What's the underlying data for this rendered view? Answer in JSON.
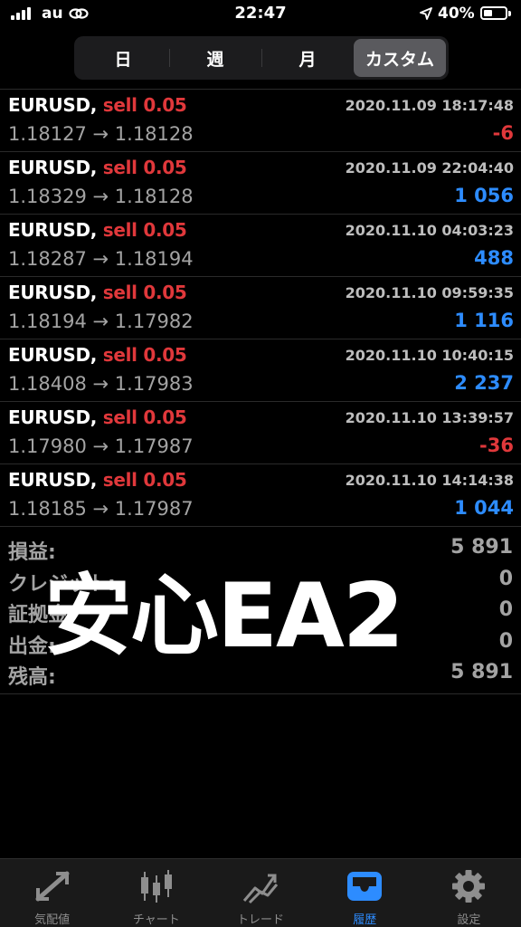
{
  "status_bar": {
    "carrier": "au",
    "time": "22:47",
    "battery": "40%",
    "battery_level": 0.4
  },
  "segments": [
    {
      "label": "日",
      "active": false
    },
    {
      "label": "週",
      "active": false
    },
    {
      "label": "月",
      "active": false
    },
    {
      "label": "カスタム",
      "active": true
    }
  ],
  "trades": [
    {
      "symbol": "EURUSD,",
      "side": "sell 0.05",
      "time": "2020.11.09 18:17:48",
      "prices": "1.18127 → 1.18128",
      "profit": "-6",
      "positive": false
    },
    {
      "symbol": "EURUSD,",
      "side": "sell 0.05",
      "time": "2020.11.09 22:04:40",
      "prices": "1.18329 → 1.18128",
      "profit": "1 056",
      "positive": true
    },
    {
      "symbol": "EURUSD,",
      "side": "sell 0.05",
      "time": "2020.11.10 04:03:23",
      "prices": "1.18287 → 1.18194",
      "profit": "488",
      "positive": true
    },
    {
      "symbol": "EURUSD,",
      "side": "sell 0.05",
      "time": "2020.11.10 09:59:35",
      "prices": "1.18194 → 1.17982",
      "profit": "1 116",
      "positive": true
    },
    {
      "symbol": "EURUSD,",
      "side": "sell 0.05",
      "time": "2020.11.10 10:40:15",
      "prices": "1.18408 → 1.17983",
      "profit": "2 237",
      "positive": true
    },
    {
      "symbol": "EURUSD,",
      "side": "sell 0.05",
      "time": "2020.11.10 13:39:57",
      "prices": "1.17980 → 1.17987",
      "profit": "-36",
      "positive": false
    },
    {
      "symbol": "EURUSD,",
      "side": "sell 0.05",
      "time": "2020.11.10 14:14:38",
      "prices": "1.18185 → 1.17987",
      "profit": "1 044",
      "positive": true
    }
  ],
  "summary": [
    {
      "label": "損益:",
      "value": "5 891"
    },
    {
      "label": "クレジット:",
      "value": "0"
    },
    {
      "label": "証拠金:",
      "value": "0"
    },
    {
      "label": "出金:",
      "value": "0"
    },
    {
      "label": "残高:",
      "value": "5 891"
    }
  ],
  "overlay_text": "安心EA2",
  "tabs": [
    {
      "label": "気配値",
      "icon": "quotes-icon",
      "active": false
    },
    {
      "label": "チャート",
      "icon": "candlestick-icon",
      "active": false
    },
    {
      "label": "トレード",
      "icon": "trade-icon",
      "active": false
    },
    {
      "label": "履歴",
      "icon": "history-inbox-icon",
      "active": true
    },
    {
      "label": "設定",
      "icon": "gear-icon",
      "active": false
    }
  ],
  "colors": {
    "positive": "#2d8cff",
    "negative": "#e0383b",
    "active_tab": "#2d8cff"
  }
}
